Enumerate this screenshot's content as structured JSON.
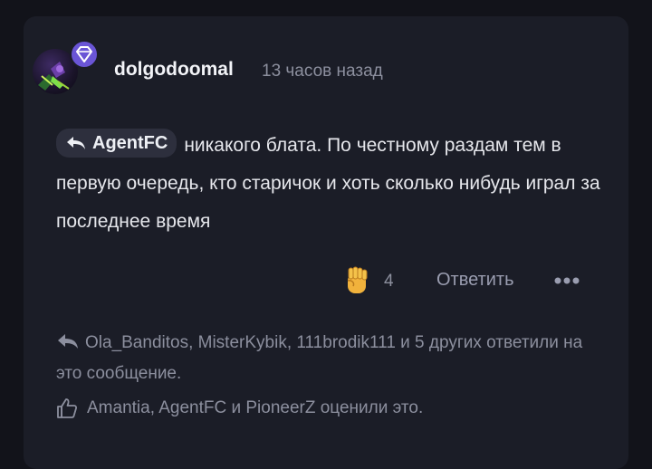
{
  "post": {
    "author": "dolgodoomal",
    "time": "13 часов назад",
    "reply_to": "AgentFC",
    "text": "никакого блата. По честному раздам тем в первую очередь, кто старичок и хоть сколько нибудь играл за последнее время"
  },
  "actions": {
    "reaction_emoji": "✊",
    "reaction_count": "4",
    "reply_label": "Ответить",
    "more_label": "•••"
  },
  "replies_summary": "Ola_Banditos, MisterKybik, 111brodik111 и 5 других ответили на это сообщение.",
  "likes_summary": "Amantia, AgentFC и PioneerZ оценили это.",
  "colors": {
    "background": "#12131a",
    "card": "#1b1d27",
    "chip": "#2d2f3d",
    "muted": "#8c8f9e",
    "badge": "#6a55d6"
  },
  "icons": [
    "diamond-badge-icon",
    "reply-arrow-icon",
    "fist-emoji-icon",
    "more-dots-icon",
    "thumbs-up-icon"
  ]
}
